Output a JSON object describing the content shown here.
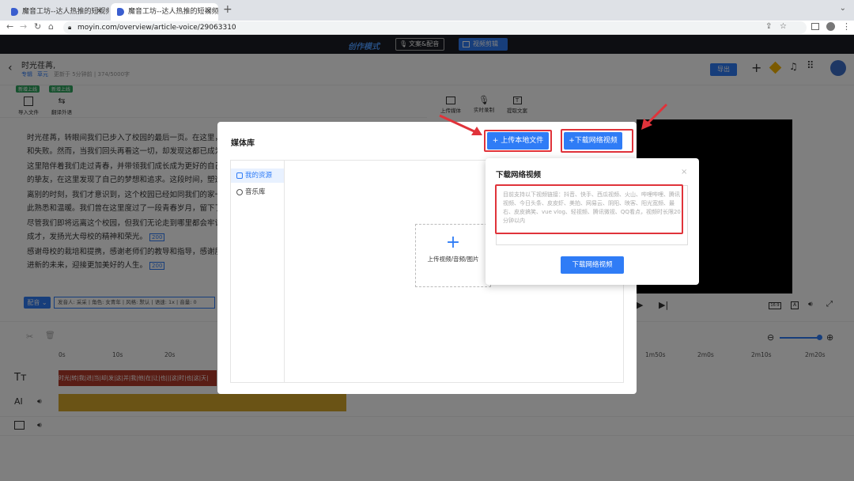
{
  "browser": {
    "tab1_title": "魔音工坊--达人热推的短视频/有",
    "tab2_title": "魔音工坊--达人热推的短视频/有",
    "url": "moyin.com/overview/article-voice/29063310"
  },
  "app_header": {
    "mode_label": "创作模式",
    "tab_text_voice": "文案&配音",
    "tab_video_edit": "视频剪辑"
  },
  "doc_header": {
    "title": "时光荏苒,",
    "tag1": "专辑",
    "tag2": "草元",
    "meta": "更新于 5分钟前 | 374/5000字",
    "export_btn": "导出"
  },
  "left_tools": {
    "badge1": "新增上线",
    "badge2": "新增上线",
    "import_text": "导入文件",
    "translate": "翻译外语"
  },
  "right_tools": {
    "upload_media": "上传媒体",
    "realtime_record": "实时录制",
    "extract_text": "提取文案"
  },
  "article": {
    "p1a": "时光荏苒，转眼间我们已步入了校园的最后一页。在这里，我",
    "p1b": "和失败。然而，当我们回头再看这一切，却发现这都已成为人",
    "p2a": "这里陪伴着我们走过青春，并带领我们成长成为更好的自己。",
    "p2b": "的挚友，在这里发现了自己的梦想和追求。这段时间，塑造了",
    "p3a": "离别的时刻，我们才意识到，这个校园已经如同我们的家一样",
    "p3b": "此熟悉和温暖。我们曾在这里度过了一段青春岁月，留下了点",
    "p4a": "尽管我们即将远离这个校园，但我们无论走到哪里都会牢记这",
    "p4b": "成才，发扬光大母校的精神和荣光。",
    "p4_badge": "200",
    "p5a": "感谢母校的栽培和提携，感谢老师们的教导和指导，感谢朋友",
    "p5b": "进新的未来，迎接更加美好的人生。",
    "p5_badge": "200"
  },
  "voice_bar": {
    "dub_btn": "配音",
    "settings": "发音人: 采采 | 角色: 女青年 | 风格: 默认 | 语速: 1x | 音量: 0"
  },
  "timeline": {
    "ticks": [
      "0s",
      "10s",
      "20s",
      "1m50s",
      "2m0s",
      "2m10s",
      "2m20s"
    ],
    "track_text": "时光|转|我|进|当|却|发|这|并|我|他|在|让|也|||这|时|也|这|天|"
  },
  "modal": {
    "title": "媒体库",
    "upload_local_btn": "+ 上传本地文件",
    "download_net_btn": "+下载网络视频",
    "side_my_resources": "我的资源",
    "side_music_lib": "音乐库",
    "upload_card_label": "上传视频/音频/图片",
    "upload_plus": "+"
  },
  "download_popup": {
    "title": "下载网络视频",
    "close": "×",
    "placeholder": "目前支持以下视频链接：抖音、快手、西瓜视频、火山、哔哩哔哩、腾讯视频、今日头条、皮皮虾、美拍、网易云、阴阳、映客、阳光宽频、最右、皮皮搞笑、vue vlog、轻视频、腾讯微视、QQ看点，视频时长限20分钟以内",
    "confirm_btn": "下载网络视频"
  },
  "colors": {
    "accent": "#2f7cf6",
    "annotation_red": "#e0333a"
  }
}
